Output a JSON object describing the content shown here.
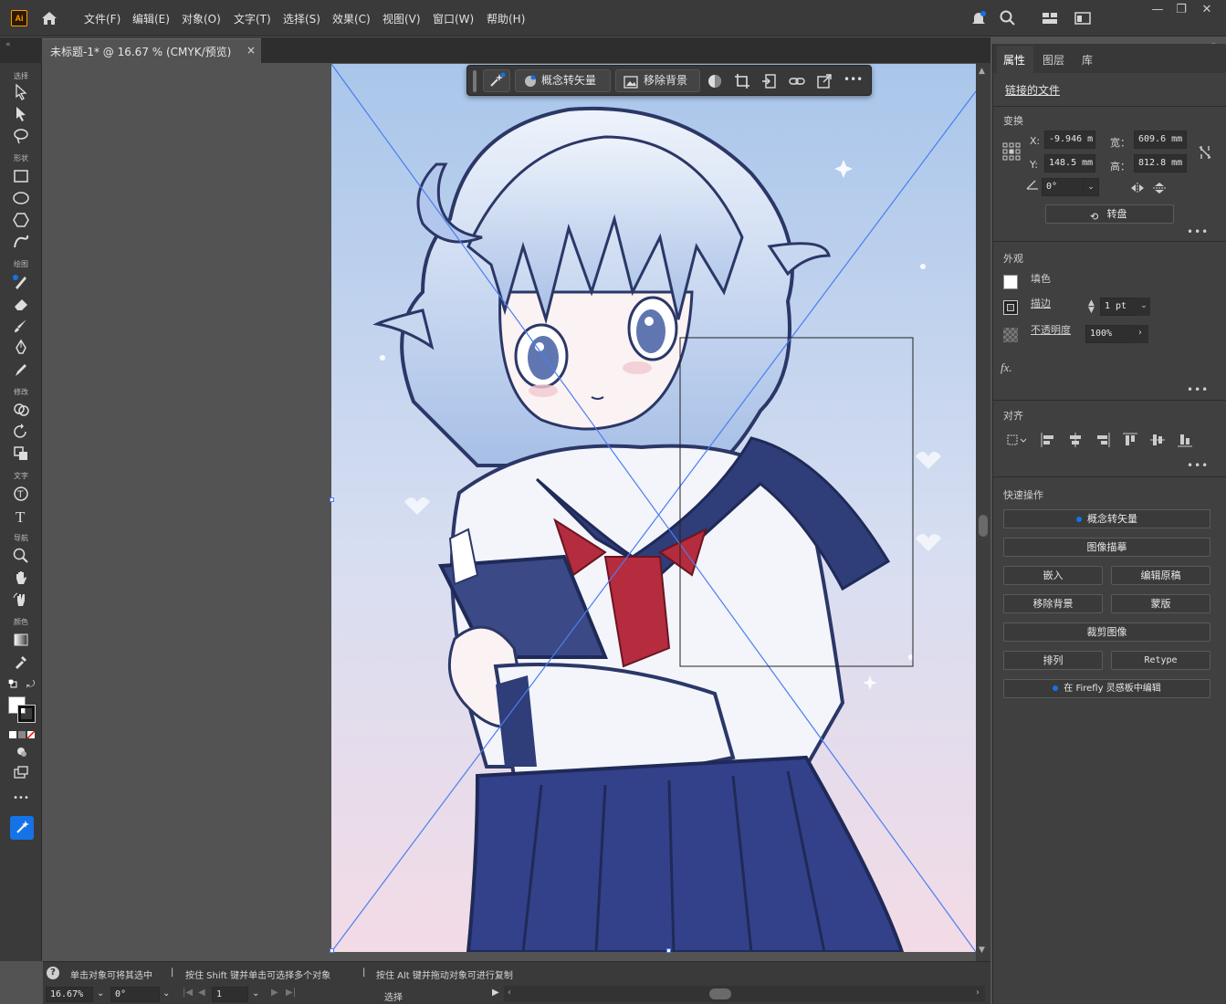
{
  "app": {
    "logo": "Ai"
  },
  "menu": [
    "文件(F)",
    "编辑(E)",
    "对象(O)",
    "文字(T)",
    "选择(S)",
    "效果(C)",
    "视图(V)",
    "窗口(W)",
    "帮助(H)"
  ],
  "doc_tab": {
    "title": "未标题-1* @ 16.67 % (CMYK/预览)",
    "close": "×"
  },
  "toolbar": {
    "sections": {
      "select": "选择",
      "shape": "形状",
      "draw": "绘图",
      "modify": "修改",
      "text": "文字",
      "nav": "导航",
      "color": "颜色"
    },
    "more": "•••"
  },
  "context_bar": {
    "vectorize": "概念转矢量",
    "remove_bg": "移除背景",
    "more": "•••"
  },
  "panel": {
    "tabs": [
      "属性",
      "图层",
      "库"
    ],
    "linked_file": "链接的文件",
    "transform": {
      "title": "变换",
      "x_label": "X:",
      "x": "-9.946 m",
      "y_label": "Y:",
      "y": "148.5 mm",
      "w_label": "宽：",
      "w": "609.6 mm",
      "h_label": "高：",
      "h": "812.8 mm",
      "angle": "0°",
      "rotate_btn": "转盘"
    },
    "appearance": {
      "title": "外观",
      "fill": "填色",
      "stroke": "描边",
      "stroke_value": "1 pt",
      "opacity": "不透明度",
      "opacity_value": "100%",
      "fx": "fx."
    },
    "align": {
      "title": "对齐"
    },
    "quick": {
      "title": "快速操作",
      "b1": "概念转矢量",
      "b2": "图像描摹",
      "b3": "嵌入",
      "b4": "编辑原稿",
      "b5": "移除背景",
      "b6": "蒙版",
      "b7": "裁剪图像",
      "b8": "排列",
      "b9": "Retype",
      "b10": "在 Firefly 灵感板中编辑"
    },
    "more": "•••"
  },
  "status": {
    "help": "?",
    "hint1": "单击对象可将其选中",
    "hint2": "按住 Shift 键并单击可选择多个对象",
    "hint3": "按住 Alt 键并拖动对象可进行复制",
    "sep": "|",
    "zoom": "16.67%",
    "rotation": "0°",
    "page": "1",
    "mode": "选择"
  },
  "colors": {
    "accent": "#1473e6",
    "artboard_top": "#a9c6ea",
    "artboard_bottom": "#f3dbe6"
  }
}
